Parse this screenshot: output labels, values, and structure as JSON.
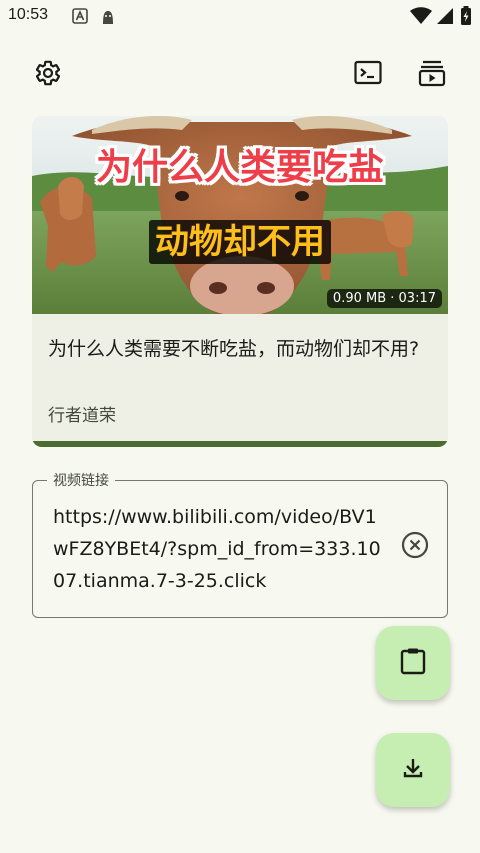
{
  "status_bar": {
    "time": "10:53",
    "icons": [
      "a-notification-icon",
      "android-bot-icon",
      "wifi-icon",
      "signal-icon",
      "battery-icon"
    ]
  },
  "toolbar": {
    "settings_icon": "gear-icon",
    "terminal_icon": "terminal-icon",
    "playlist_icon": "subscriptions-icon"
  },
  "video_card": {
    "thumbnail_caption_top": "为什么人类要吃盐",
    "thumbnail_caption_bottom": "动物却不用",
    "meta": "0.90 MB · 03:17",
    "title": "为什么人类需要不断吃盐，而动物们却不用?",
    "author": "行者道荣",
    "progress": 1.0
  },
  "url_field": {
    "label": "视频链接",
    "value": "https://www.bilibili.com/video/BV1wFZ8YBEt4/?spm_id_from=333.1007.tianma.7-3-25.click",
    "clear_icon": "clear-circle-icon"
  },
  "fabs": {
    "paste_icon": "clipboard-icon",
    "download_icon": "download-icon"
  },
  "colors": {
    "background": "#f7f8ef",
    "fab": "#c6eeb3",
    "progress": "#4a6b32"
  }
}
